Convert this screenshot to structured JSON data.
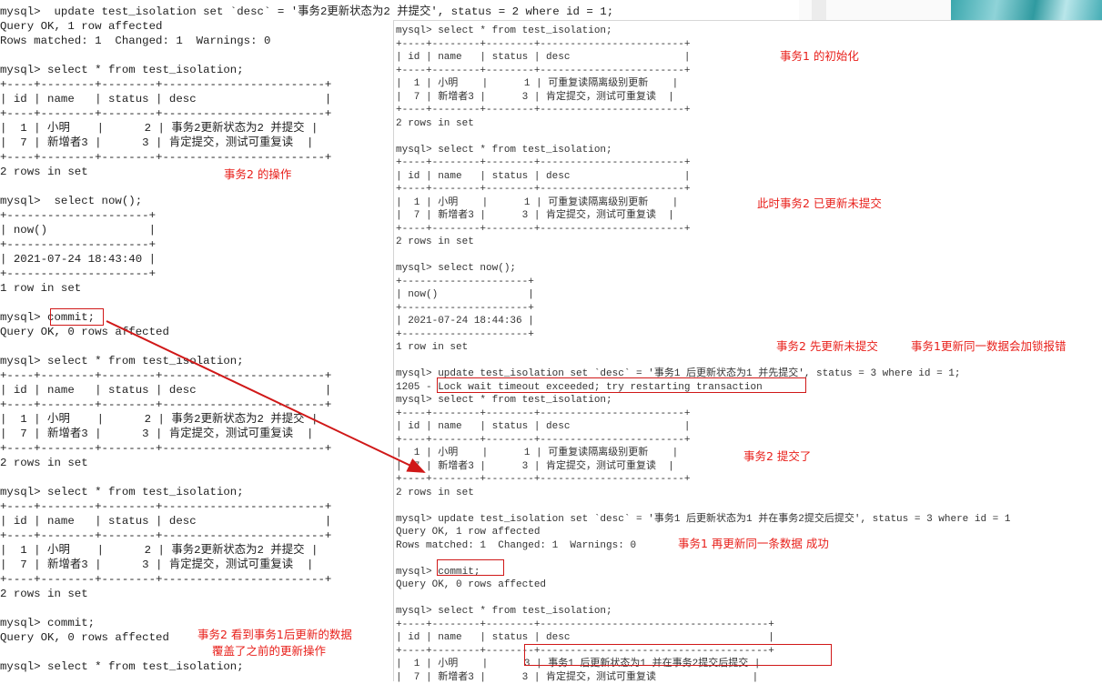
{
  "left_terminal": {
    "lines": [
      "mysql>  update test_isolation set `desc` = '事务2更新状态为2 并提交', status = 2 where id = 1;",
      "Query OK, 1 row affected",
      "Rows matched: 1  Changed: 1  Warnings: 0",
      "",
      "mysql> select * from test_isolation;",
      "+----+--------+--------+------------------------+",
      "| id | name   | status | desc                   |",
      "+----+--------+--------+------------------------+",
      "|  1 | 小明    |      2 | 事务2更新状态为2 并提交 |",
      "|  7 | 新增者3 |      3 | 肯定提交，测试可重复读  |",
      "+----+--------+--------+------------------------+",
      "2 rows in set",
      "",
      "mysql>  select now();",
      "+---------------------+",
      "| now()               |",
      "+---------------------+",
      "| 2021-07-24 18:43:40 |",
      "+---------------------+",
      "1 row in set",
      "",
      "mysql> commit;",
      "Query OK, 0 rows affected",
      "",
      "mysql> select * from test_isolation;",
      "+----+--------+--------+------------------------+",
      "| id | name   | status | desc                   |",
      "+----+--------+--------+------------------------+",
      "|  1 | 小明    |      2 | 事务2更新状态为2 并提交 |",
      "|  7 | 新增者3 |      3 | 肯定提交，测试可重复读  |",
      "+----+--------+--------+------------------------+",
      "2 rows in set",
      "",
      "mysql> select * from test_isolation;",
      "+----+--------+--------+------------------------+",
      "| id | name   | status | desc                   |",
      "+----+--------+--------+------------------------+",
      "|  1 | 小明    |      2 | 事务2更新状态为2 并提交 |",
      "|  7 | 新增者3 |      3 | 肯定提交，测试可重复读  |",
      "+----+--------+--------+------------------------+",
      "2 rows in set",
      "",
      "mysql> commit;",
      "Query OK, 0 rows affected",
      "",
      "mysql> select * from test_isolation;"
    ]
  },
  "right_terminal": {
    "lines": [
      "mysql> select * from test_isolation;",
      "+----+--------+--------+------------------------+",
      "| id | name   | status | desc                   |",
      "+----+--------+--------+------------------------+",
      "|  1 | 小明    |      1 | 可重复读隔离级别更新    |",
      "|  7 | 新增者3 |      3 | 肯定提交，测试可重复读  |",
      "+----+--------+--------+------------------------+",
      "2 rows in set",
      "",
      "mysql> select * from test_isolation;",
      "+----+--------+--------+------------------------+",
      "| id | name   | status | desc                   |",
      "+----+--------+--------+------------------------+",
      "|  1 | 小明    |      1 | 可重复读隔离级别更新    |",
      "|  7 | 新增者3 |      3 | 肯定提交，测试可重复读  |",
      "+----+--------+--------+------------------------+",
      "2 rows in set",
      "",
      "mysql> select now();",
      "+---------------------+",
      "| now()               |",
      "+---------------------+",
      "| 2021-07-24 18:44:36 |",
      "+---------------------+",
      "1 row in set",
      "",
      "mysql> update test_isolation set `desc` = '事务1 后更新状态为1 并先提交', status = 3 where id = 1;",
      "1205 - Lock wait timeout exceeded; try restarting transaction",
      "mysql> select * from test_isolation;",
      "+----+--------+--------+------------------------+",
      "| id | name   | status | desc                   |",
      "+----+--------+--------+------------------------+",
      "|  1 | 小明    |      1 | 可重复读隔离级别更新    |",
      "|  7 | 新增者3 |      3 | 肯定提交，测试可重复读  |",
      "+----+--------+--------+------------------------+",
      "2 rows in set",
      "",
      "mysql> update test_isolation set `desc` = '事务1 后更新状态为1 并在事务2提交后提交', status = 3 where id = 1",
      "Query OK, 1 row affected",
      "Rows matched: 1  Changed: 1  Warnings: 0",
      "",
      "mysql> commit;",
      "Query OK, 0 rows affected",
      "",
      "mysql> select * from test_isolation;",
      "+----+--------+--------+--------------------------------------+",
      "| id | name   | status | desc                                 |",
      "+----+--------+--------+--------------------------------------+",
      "|  1 | 小明    |      3 | 事务1 后更新状态为1 并在事务2提交后提交 |",
      "|  7 | 新增者3 |      3 | 肯定提交，测试可重复读                |"
    ]
  },
  "annotations": {
    "tx2_operation": "事务2 的操作",
    "tx1_init": "事务1 的初始化",
    "tx2_updated_uncommitted": "此时事务2 已更新未提交",
    "tx2_update_first": "事务2 先更新未提交",
    "tx1_lock_error": "事务1更新同一数据会加锁报错",
    "tx2_committed": "事务2 提交了",
    "tx1_update_success": "事务1 再更新同一条数据 成功",
    "tx2_sees_line1": "事务2 看到事务1后更新的数据",
    "tx2_sees_line2": "覆盖了之前的更新操作"
  },
  "colors": {
    "annotation_red": "#e8201b",
    "highlight_box": "#d01818"
  }
}
